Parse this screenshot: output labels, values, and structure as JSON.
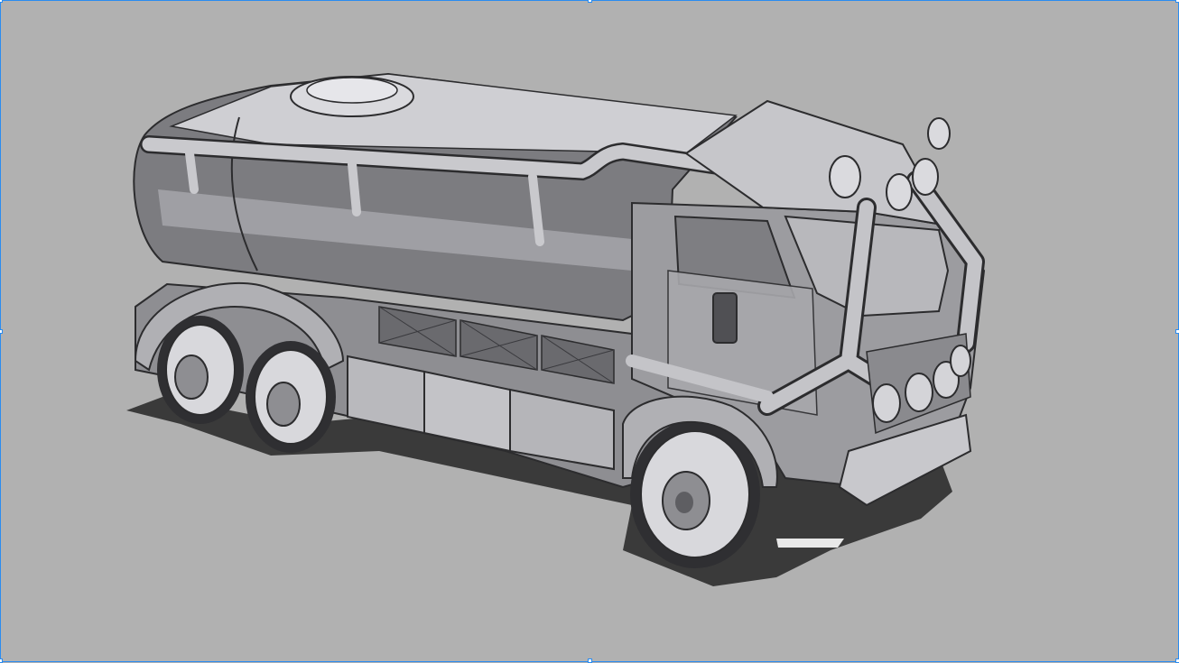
{
  "canvas": {
    "background": "#b1b1b1"
  },
  "selection": {
    "border_color": "#2a8cf0",
    "handle_fill": "#ffffff"
  },
  "artwork": {
    "subject": "tanker-truck-sketch",
    "palette": {
      "light": "#d6d6d8",
      "mid": "#a2a2a6",
      "dark": "#5e5e62",
      "shadow": "#3a3a3a",
      "line": "#2c2c2e"
    }
  }
}
